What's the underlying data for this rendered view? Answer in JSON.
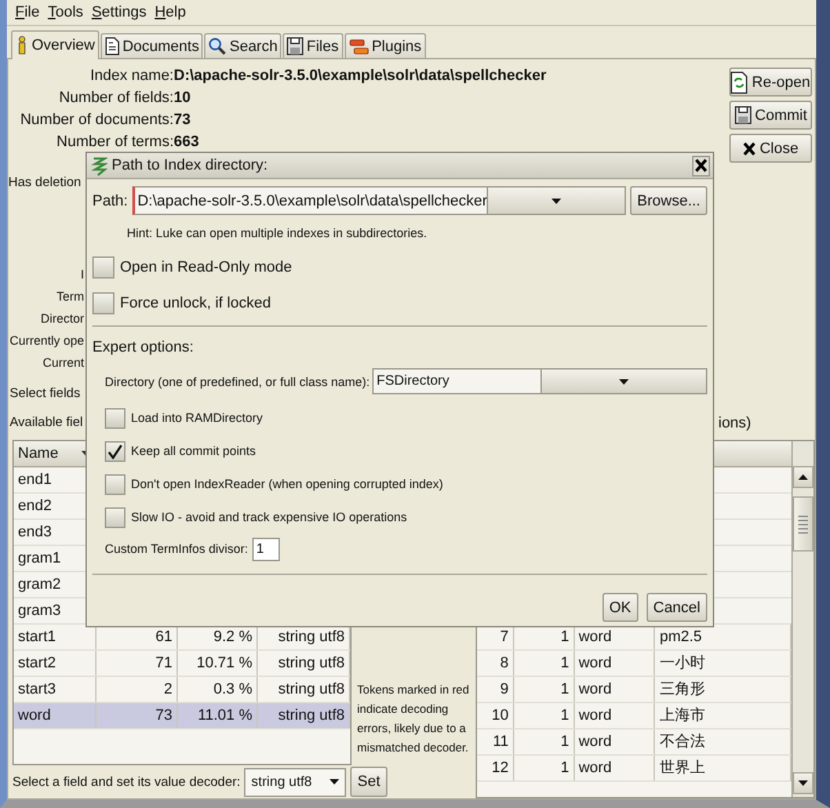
{
  "menu": [
    {
      "label": "File"
    },
    {
      "label": "Tools"
    },
    {
      "label": "Settings"
    },
    {
      "label": "Help"
    }
  ],
  "tabs": [
    {
      "label": "Overview",
      "selected": true
    },
    {
      "label": "Documents",
      "selected": false
    },
    {
      "label": "Search",
      "selected": false
    },
    {
      "label": "Files",
      "selected": false
    },
    {
      "label": "Plugins",
      "selected": false
    }
  ],
  "overview": {
    "stats": [
      {
        "label": "Index name:",
        "value": "D:\\apache-solr-3.5.0\\example\\solr\\data\\spellchecker"
      },
      {
        "label": "Number of fields:",
        "value": "10"
      },
      {
        "label": "Number of documents:",
        "value": "73"
      },
      {
        "label": "Number of terms:",
        "value": "663"
      }
    ],
    "has_deletions_label": "Has deletion",
    "covered_labels": [
      "I",
      "Term",
      "Director",
      "Currently ope",
      "Current"
    ]
  },
  "actions": [
    {
      "label": "Re-open"
    },
    {
      "label": "Commit"
    },
    {
      "label": "Close"
    }
  ],
  "fields": {
    "select_label": "Select fields",
    "available_label": "Available fiel",
    "columns": [
      "Name"
    ],
    "rows": [
      {
        "name": "end1",
        "selected": false
      },
      {
        "name": "end2",
        "selected": false
      },
      {
        "name": "end3",
        "selected": false
      },
      {
        "name": "gram1",
        "selected": false
      },
      {
        "name": "gram2",
        "selected": false
      },
      {
        "name": "gram3",
        "selected": false
      },
      {
        "name": "start1",
        "count": "61",
        "percent": "9.2 %",
        "decoder": "string utf8",
        "selected": false
      },
      {
        "name": "start2",
        "count": "71",
        "percent": "10.71 %",
        "decoder": "string utf8",
        "selected": false
      },
      {
        "name": "start3",
        "count": "2",
        "percent": "0.3 %",
        "decoder": "string utf8",
        "selected": false
      },
      {
        "name": "word",
        "count": "73",
        "percent": "11.01 %",
        "decoder": "string utf8",
        "selected": true
      }
    ],
    "decoder_label": "Select a field and set its value decoder:",
    "decoder_value": "string utf8",
    "set_button": "Set"
  },
  "decoding_note": "Tokens marked in red indicate decoding errors, likely due to a mismatched decoder.",
  "terms": {
    "header_tail": "ions)",
    "rows": [
      {
        "rank": "7",
        "freq": "1",
        "field": "word",
        "text": "pm2.5"
      },
      {
        "rank": "8",
        "freq": "1",
        "field": "word",
        "text": "一小时"
      },
      {
        "rank": "9",
        "freq": "1",
        "field": "word",
        "text": "三角形"
      },
      {
        "rank": "10",
        "freq": "1",
        "field": "word",
        "text": "上海市"
      },
      {
        "rank": "11",
        "freq": "1",
        "field": "word",
        "text": "不合法"
      },
      {
        "rank": "12",
        "freq": "1",
        "field": "word",
        "text": "世界上"
      }
    ]
  },
  "dialog": {
    "title": "Path to Index directory:",
    "path_label": "Path:",
    "path_value": "D:\\apache-solr-3.5.0\\example\\solr\\data\\spellchecker",
    "browse_button": "Browse...",
    "hint": "Hint: Luke can open multiple indexes in subdirectories.",
    "options": [
      {
        "label": "Open in Read-Only mode",
        "checked": false
      },
      {
        "label": "Force unlock, if locked",
        "checked": false
      }
    ],
    "expert_label": "Expert options:",
    "directory_label": "Directory (one of predefined, or full class name):",
    "directory_value": "FSDirectory",
    "expert_options": [
      {
        "label": "Load into RAMDirectory",
        "checked": false
      },
      {
        "label": "Keep all commit points",
        "checked": true
      },
      {
        "label": "Don't open IndexReader (when opening corrupted index)",
        "checked": false
      },
      {
        "label": "Slow IO - avoid and track expensive IO operations",
        "checked": false
      }
    ],
    "divisor_label": "Custom TermInfos divisor:",
    "divisor_value": "1",
    "buttons": [
      "OK",
      "Cancel"
    ]
  }
}
